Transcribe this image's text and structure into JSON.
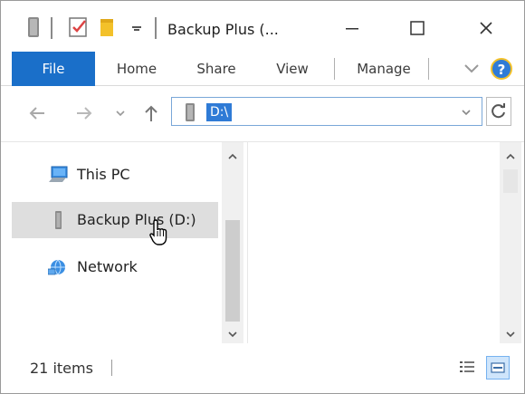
{
  "window": {
    "title": "Backup Plus (...",
    "controls": {
      "minimize_icon": "minimize-icon",
      "maximize_icon": "maximize-icon",
      "close_icon": "close-icon"
    }
  },
  "ribbon": {
    "tabs": [
      {
        "label": "File",
        "active": true
      },
      {
        "label": "Home",
        "active": false
      },
      {
        "label": "Share",
        "active": false
      },
      {
        "label": "View",
        "active": false
      },
      {
        "label": "Manage",
        "active": false
      }
    ]
  },
  "address_bar": {
    "path": "D:\\"
  },
  "nav_pane": {
    "items": [
      {
        "label": "This PC",
        "icon": "computer-icon"
      },
      {
        "label": "Backup Plus (D:)",
        "icon": "drive-icon",
        "selected": true
      },
      {
        "label": "Network",
        "icon": "network-icon"
      }
    ]
  },
  "status_bar": {
    "items_text": "21 items"
  },
  "colors": {
    "accent": "#1a6fc9",
    "selection": "#dedede",
    "address_highlight": "#2f7bd6"
  }
}
